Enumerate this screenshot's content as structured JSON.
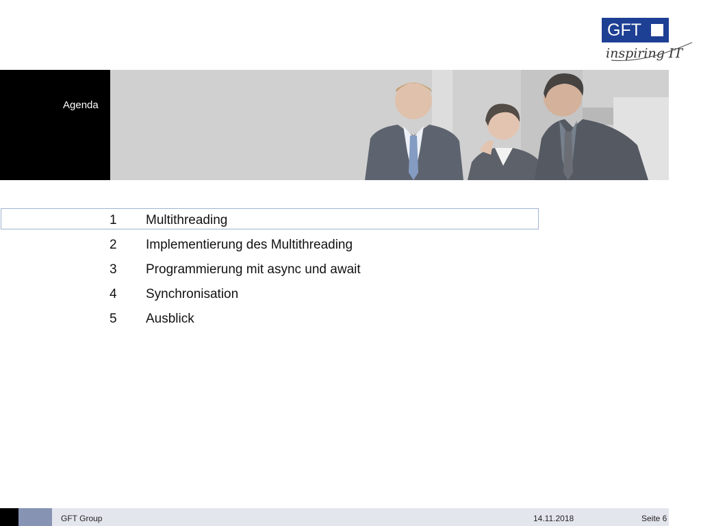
{
  "logo": {
    "name": "GFT",
    "tagline": "inspiring IT",
    "brand_color": "#1d3f94"
  },
  "header": {
    "title": "Agenda"
  },
  "agenda": {
    "items": [
      {
        "number": "1",
        "label": "Multithreading",
        "active": true
      },
      {
        "number": "2",
        "label": "Implementierung des Multithreading",
        "active": false
      },
      {
        "number": "3",
        "label": "Programmierung mit async und await",
        "active": false
      },
      {
        "number": "4",
        "label": "Synchronisation",
        "active": false
      },
      {
        "number": "5",
        "label": "Ausblick",
        "active": false
      }
    ]
  },
  "footer": {
    "company": "GFT Group",
    "date": "14.11.2018",
    "page": "Seite 6"
  }
}
